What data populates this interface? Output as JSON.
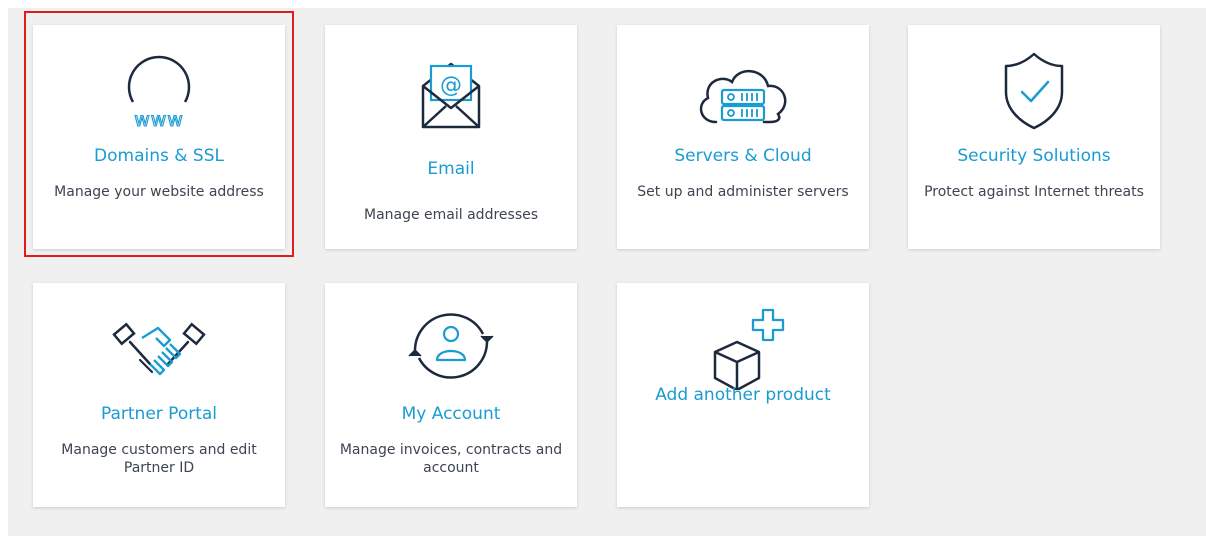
{
  "products": [
    {
      "title": "Domains & SSL",
      "description": "Manage your website address",
      "icon": "www-globe-icon"
    },
    {
      "title": "Email",
      "description": "Manage email addresses",
      "icon": "envelope-at-icon"
    },
    {
      "title": "Servers & Cloud",
      "description": "Set up and administer servers",
      "icon": "cloud-server-icon"
    },
    {
      "title": "Security Solutions",
      "description": "Protect against Internet threats",
      "icon": "shield-check-icon"
    },
    {
      "title": "Partner Portal",
      "description": "Manage customers and edit Partner ID",
      "icon": "handshake-icon"
    },
    {
      "title": "My Account",
      "description": "Manage invoices, contracts and account",
      "icon": "user-cycle-icon"
    }
  ],
  "add_product": {
    "title": "Add another product",
    "icon": "box-plus-icon"
  },
  "colors": {
    "accent": "#1a9bd2",
    "icon_dark": "#1d2a3e",
    "highlight": "#e21b1b",
    "text": "#3d4552"
  }
}
